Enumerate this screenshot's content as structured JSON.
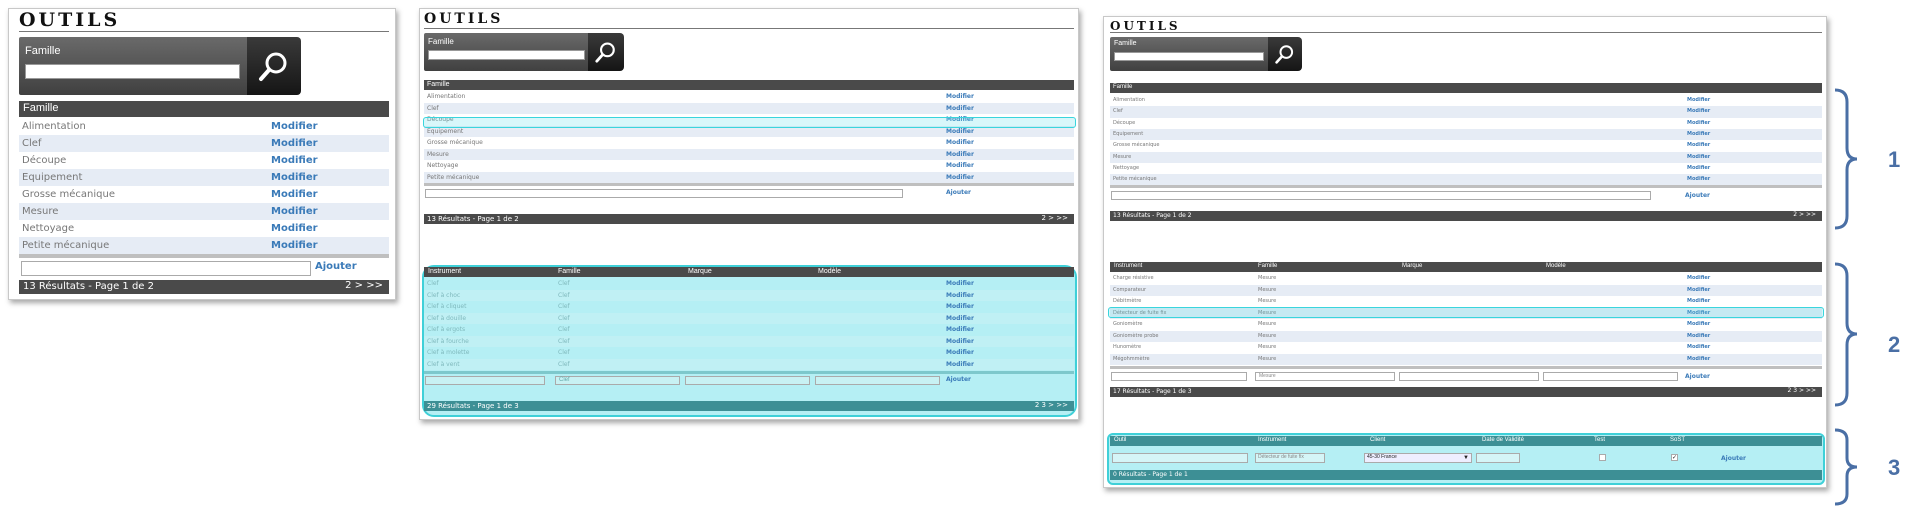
{
  "title": "OUTILS",
  "search": {
    "label": "Famille",
    "placeholder": ""
  },
  "famille_table": {
    "header": "Famille",
    "rows": [
      "Alimentation",
      "Clef",
      "Découpe",
      "Equipement",
      "Grosse mécanique",
      "Mesure",
      "Nettoyage",
      "Petite mécanique"
    ],
    "action_label": "Modifier",
    "add_label": "Ajouter",
    "footer_results": "13 Résultats - Page 1 de 2",
    "footer_pager": "2 > >>",
    "footer_pager_small": "2 > >>"
  },
  "instrument_table_a": {
    "headers": [
      "Instrument",
      "Famille",
      "Marque",
      "Modèle"
    ],
    "rows": [
      [
        "Clef",
        "Clef"
      ],
      [
        "Clef à choc",
        "Clef"
      ],
      [
        "Clef à cliquet",
        "Clef"
      ],
      [
        "Clef à douille",
        "Clef"
      ],
      [
        "Clef à ergots",
        "Clef"
      ],
      [
        "Clef à fourche",
        "Clef"
      ],
      [
        "Clef à molette",
        "Clef"
      ],
      [
        "Clef à vent",
        "Clef"
      ]
    ],
    "action_label": "Modifier",
    "filter_famille": "Clef",
    "add_label": "Ajouter",
    "footer_results": "29 Résultats - Page 1 de 3",
    "footer_pager": "2 3 > >>"
  },
  "instrument_table_b": {
    "headers": [
      "Instrument",
      "Famille",
      "Marque",
      "Modèle"
    ],
    "rows": [
      [
        "Charge résistive",
        "Mesure"
      ],
      [
        "Comparateur",
        "Mesure"
      ],
      [
        "Débitmètre",
        "Mesure"
      ],
      [
        "Détecteur de fuite fix",
        "Mesure"
      ],
      [
        "Goniomètre",
        "Mesure"
      ],
      [
        "Goniomètre probe",
        "Mesure"
      ],
      [
        "Hunomètre",
        "Mesure"
      ],
      [
        "Mégohmmètre",
        "Mesure"
      ]
    ],
    "action_label": "Modifier",
    "filter_famille": "Mesure",
    "add_label": "Ajouter",
    "footer_results": "17 Résultats - Page 1 de 3",
    "footer_pager": "2 3 > >>"
  },
  "outil_table": {
    "headers": [
      "Outil",
      "Instrument",
      "Client",
      "Date de Validité",
      "Test",
      "SoST"
    ],
    "instrument_value": "Détecteur de fuite fix",
    "client_value": "45-30 France",
    "add_label": "Ajouter",
    "footer_results": "0 Résultats - Page 1 de 1"
  },
  "callouts": [
    "1",
    "2",
    "3"
  ],
  "colors": {
    "header_bg": "#4a4a4a",
    "link": "#3a7ab8",
    "highlight": "#3fd0d8",
    "alt_row": "#e6ecf5",
    "brace": "#4a6fa5"
  }
}
